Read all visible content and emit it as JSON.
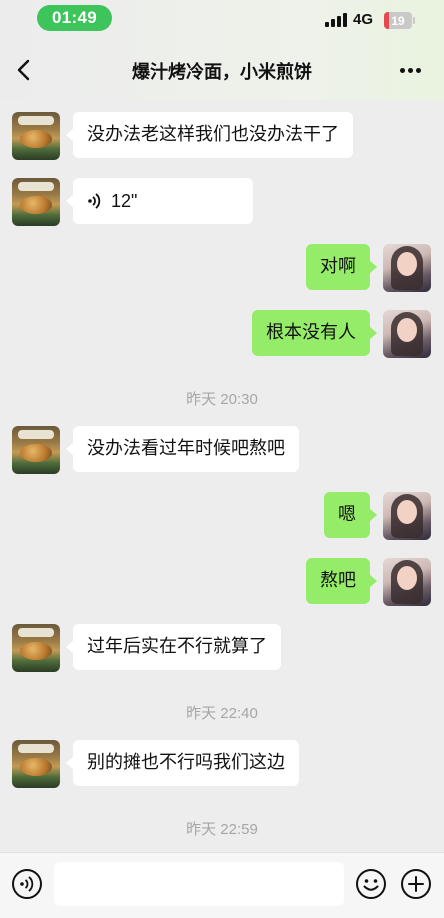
{
  "status_bar": {
    "time": "01:49",
    "network": "4G",
    "battery": "19",
    "battery_fraction": 0.19
  },
  "nav": {
    "title": "爆汁烤冷面，小米煎饼",
    "back_icon": "chevron-left-icon",
    "more_icon": "more-dots-icon"
  },
  "messages": [
    {
      "side": "in",
      "text": "没办法老这样我们也没办法干了"
    },
    {
      "side": "in",
      "type": "voice",
      "text": "12\""
    },
    {
      "side": "out",
      "text": "对啊"
    },
    {
      "side": "out",
      "text": "根本没有人"
    },
    {
      "type": "time",
      "text": "昨天 20:30"
    },
    {
      "side": "in",
      "text": "没办法看过年时候吧熬吧"
    },
    {
      "side": "out",
      "text": "嗯"
    },
    {
      "side": "out",
      "text": "熬吧"
    },
    {
      "side": "in",
      "text": "过年后实在不行就算了"
    },
    {
      "type": "time",
      "text": "昨天 22:40"
    },
    {
      "side": "in",
      "text": "别的摊也不行吗我们这边"
    },
    {
      "type": "time",
      "text": "昨天 22:59"
    }
  ],
  "input_bar": {
    "voice_icon": "voice-mode-icon",
    "emoji_icon": "emoji-icon",
    "plus_icon": "plus-circle-icon",
    "value": ""
  },
  "colors": {
    "background": "#ededed",
    "incoming_bubble": "#ffffff",
    "outgoing_bubble": "#95ec69",
    "time_pill": "#3dc45a",
    "battery_low": "#e5484d",
    "timestamp_text": "#a6a6a6"
  }
}
